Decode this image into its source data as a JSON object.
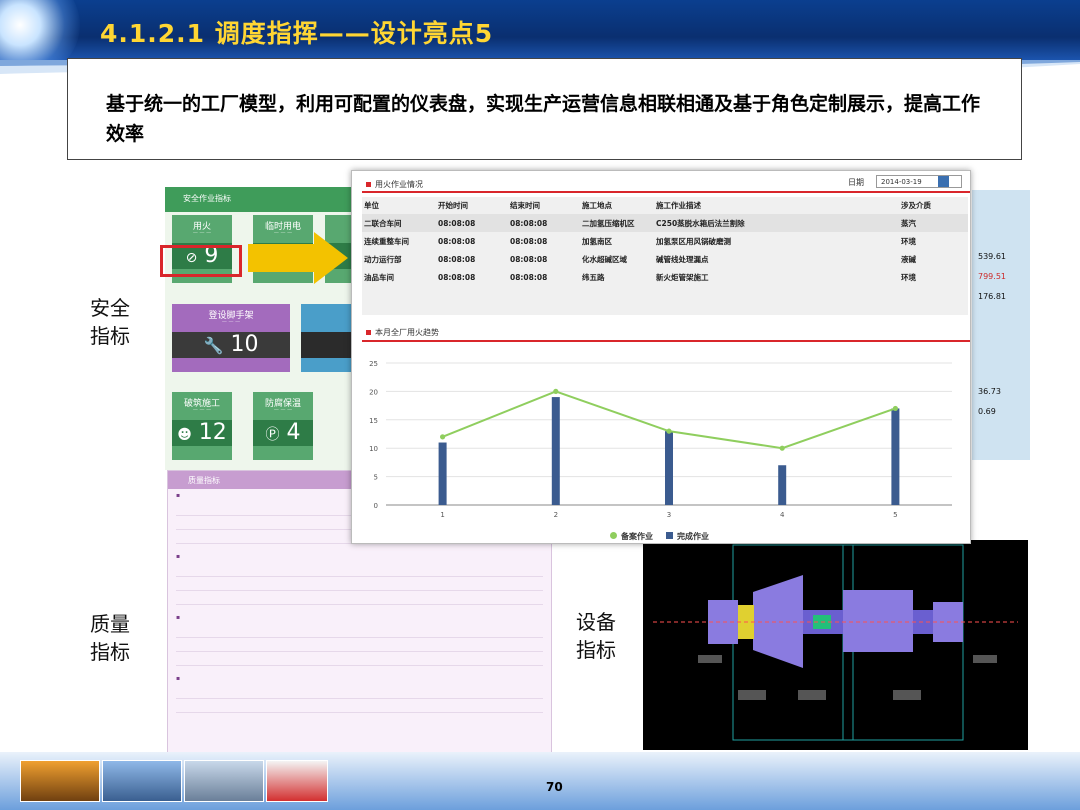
{
  "header": {
    "title": "4.1.2.1 调度指挥——设计亮点5"
  },
  "description": "基于统一的工厂模型，利用可配置的仪表盘，实现生产运营信息相联相通及基于角色定制展示，提高工作效率",
  "labels": {
    "safety": "安全\n指标",
    "quality": "质量\n指标",
    "equipment": "设备\n指标"
  },
  "safety_panel": {
    "title": "安全作业指标",
    "tiles": [
      {
        "name": "用火",
        "value": "9",
        "icon": "tag-icon",
        "color": "#58a870"
      },
      {
        "name": "临时用电",
        "value": "",
        "icon": "",
        "color": "#58a870"
      },
      {
        "name": "登设脚手架",
        "value": "10",
        "icon": "wrench-icon",
        "color": "#a36bbd"
      },
      {
        "name": "破筑施工",
        "value": "12",
        "icon": "worker-icon",
        "color": "#3f9c5a"
      },
      {
        "name": "防腐保温",
        "value": "4",
        "icon": "p-icon",
        "color": "#3f9c5a"
      }
    ]
  },
  "quality_panel": {
    "title": "质量指标"
  },
  "fire_panel": {
    "title": "用火作业情况",
    "date_label": "日期",
    "date_value": "2014-03-19",
    "columns": [
      "单位",
      "开始时间",
      "结束时间",
      "施工地点",
      "施工作业描述",
      "涉及介质"
    ],
    "rows": [
      [
        "二联合车间",
        "08:08:08",
        "08:08:08",
        "二加氢压缩机区",
        "C250蒸脱水箱后法兰割除",
        "蒸汽"
      ],
      [
        "连续重整车间",
        "08:08:08",
        "08:08:08",
        "加氢南区",
        "加氢泵区用风锅破磨测",
        "环境"
      ],
      [
        "动力运行部",
        "08:08:08",
        "08:08:08",
        "化水超碱区域",
        "碱管线处理漏点",
        "液碱"
      ],
      [
        "油品车间",
        "08:08:08",
        "08:08:08",
        "纬五路",
        "新火炬管架施工",
        "环境"
      ]
    ]
  },
  "trend_panel": {
    "title": "本月全厂用火趋势"
  },
  "chart_data": {
    "type": "bar",
    "title": "",
    "categories": [
      "1",
      "2",
      "3",
      "4",
      "5"
    ],
    "series": [
      {
        "name": "备案作业",
        "type": "line",
        "values": [
          12,
          20,
          13,
          10,
          17
        ],
        "color": "#8fce5e"
      },
      {
        "name": "完成作业",
        "type": "bar",
        "values": [
          11,
          19,
          13,
          7,
          17
        ],
        "color": "#3b5b8f"
      }
    ],
    "y_ticks": [
      "0",
      "5",
      "10",
      "15",
      "20",
      "25"
    ],
    "ylim": [
      0,
      25
    ],
    "grid": true,
    "legend": "bottom-center"
  },
  "right_panel": {
    "values": [
      "539.61",
      "799.51",
      "176.81",
      "36.73",
      "0.69"
    ],
    "highlight_color": "#cc2a2a"
  },
  "page_number": "70"
}
